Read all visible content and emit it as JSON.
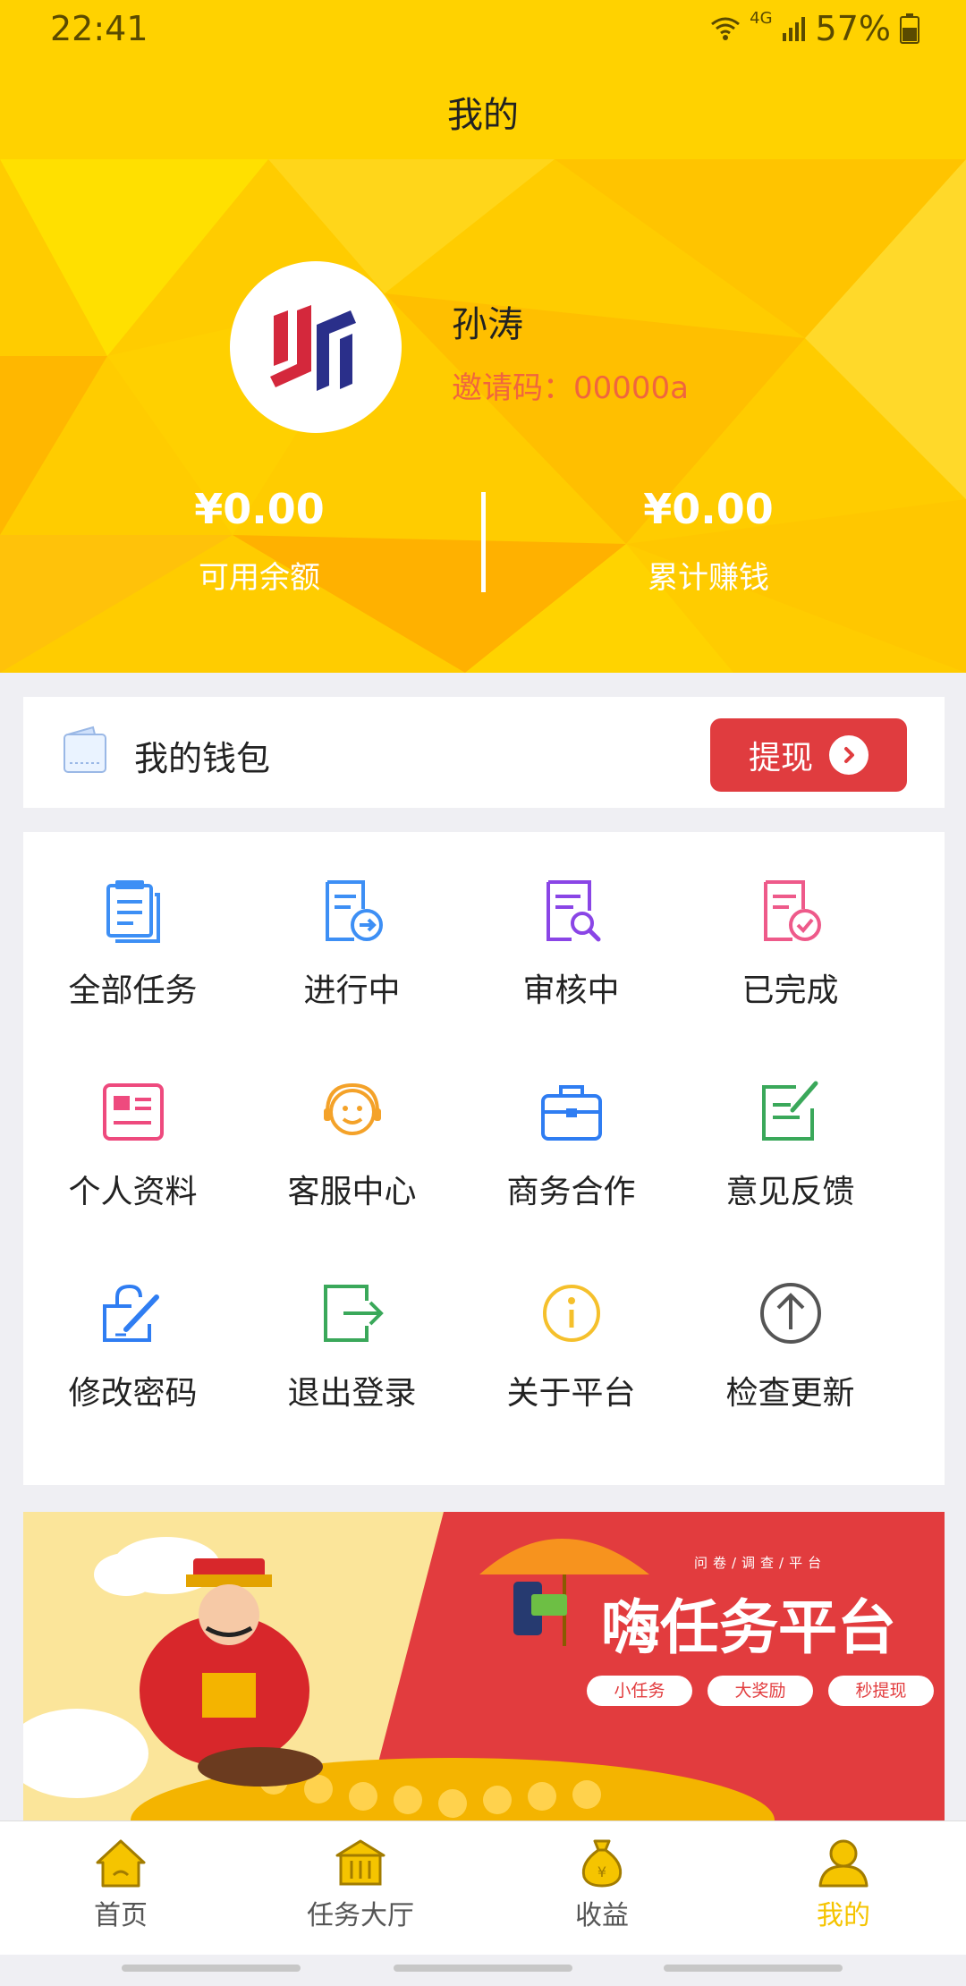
{
  "status": {
    "time": "22:41",
    "network": "4G",
    "battery": "57%"
  },
  "title": "我的",
  "profile": {
    "name": "孙涛",
    "invite_label": "邀请码：00000a"
  },
  "stats": [
    {
      "amount": "¥0.00",
      "label": "可用余额"
    },
    {
      "amount": "¥0.00",
      "label": "累计赚钱"
    }
  ],
  "wallet": {
    "label": "我的钱包",
    "button": "提现"
  },
  "menu": [
    {
      "label": "全部任务",
      "icon": "clipboard-list-icon",
      "color": "#3d8ff5"
    },
    {
      "label": "进行中",
      "icon": "doc-arrow-icon",
      "color": "#3d8ff5"
    },
    {
      "label": "审核中",
      "icon": "doc-search-icon",
      "color": "#8a45e6"
    },
    {
      "label": "已完成",
      "icon": "doc-check-icon",
      "color": "#ee5a8a"
    },
    {
      "label": "个人资料",
      "icon": "id-card-icon",
      "color": "#ee4a7e"
    },
    {
      "label": "客服中心",
      "icon": "headset-smile-icon",
      "color": "#f4a229"
    },
    {
      "label": "商务合作",
      "icon": "briefcase-icon",
      "color": "#2f7df2"
    },
    {
      "label": "意见反馈",
      "icon": "edit-note-icon",
      "color": "#3aa85a"
    },
    {
      "label": "修改密码",
      "icon": "lock-edit-icon",
      "color": "#2f7df2"
    },
    {
      "label": "退出登录",
      "icon": "logout-icon",
      "color": "#3aa85a"
    },
    {
      "label": "关于平台",
      "icon": "info-icon",
      "color": "#f5c02c"
    },
    {
      "label": "检查更新",
      "icon": "upload-arrow-icon",
      "color": "#555555"
    }
  ],
  "banner": {
    "subtitle": "问卷/调查/平台",
    "title": "嗨任务平台",
    "tags": [
      "小任务",
      "大奖励",
      "秒提现"
    ]
  },
  "nav": [
    {
      "label": "首页",
      "icon": "home-icon"
    },
    {
      "label": "任务大厅",
      "icon": "hall-icon"
    },
    {
      "label": "收益",
      "icon": "money-bag-icon"
    },
    {
      "label": "我的",
      "icon": "user-icon",
      "active": true
    }
  ],
  "colors": {
    "primary_yellow": "#ffd200",
    "accent_red": "#e03c3f",
    "invite_orange": "#f0653e",
    "active_nav": "#f5c400"
  }
}
